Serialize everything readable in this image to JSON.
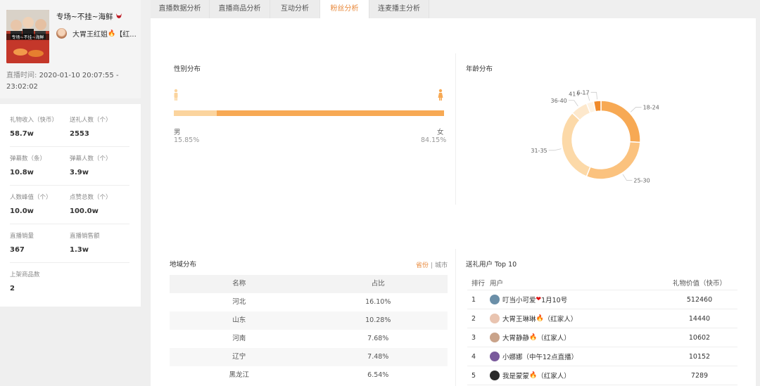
{
  "stream": {
    "title": "专场~不挂~海鲜",
    "thumbnail_caption": "专场~不挂~海鲜",
    "host_name": "大胃王红姐",
    "host_suffix": "【红...",
    "time_label": "直播时间:",
    "time_value": "2020-01-10 20:07:55 - 23:02:02"
  },
  "stats": [
    {
      "label": "礼物收入（快币）",
      "value": "58.7w"
    },
    {
      "label": "送礼人数（个）",
      "value": "2553"
    },
    {
      "label": "弹幕数（条）",
      "value": "10.8w"
    },
    {
      "label": "弹幕人数（个）",
      "value": "3.9w"
    },
    {
      "label": "人数峰值（个）",
      "value": "10.0w"
    },
    {
      "label": "点赞总数（个）",
      "value": "100.0w"
    },
    {
      "label": "直播销量",
      "value": "367"
    },
    {
      "label": "直播销售额",
      "value": "1.3w"
    },
    {
      "label": "上架商品数",
      "value": "2"
    }
  ],
  "tabs": [
    {
      "label": "直播数据分析",
      "active": false
    },
    {
      "label": "直播商品分析",
      "active": false
    },
    {
      "label": "互动分析",
      "active": false
    },
    {
      "label": "粉丝分析",
      "active": true
    },
    {
      "label": "连麦播主分析",
      "active": false
    }
  ],
  "gender": {
    "title": "性别分布",
    "male_label": "男",
    "male_pct": "15.85%",
    "male_fraction": 0.1585,
    "female_label": "女",
    "female_pct": "84.15%",
    "colors": {
      "male": "#fbd49e",
      "female": "#f7a954"
    }
  },
  "age": {
    "title": "年龄分布",
    "chart_data": {
      "type": "pie",
      "categories": [
        "18-24",
        "25-30",
        "31-35",
        "36-40",
        "41+",
        "6-17"
      ],
      "values": [
        26,
        30,
        31,
        7,
        3,
        3
      ],
      "colors": [
        "#f7a954",
        "#fbc27e",
        "#fcd9a8",
        "#fde8cc",
        "#fef3e4",
        "#f08a2a"
      ],
      "legend": "none",
      "labels": "outside"
    }
  },
  "region": {
    "title": "地域分布",
    "toggle_province": "省份",
    "toggle_sep": "|",
    "toggle_city": "城市",
    "headers": [
      "名称",
      "占比"
    ],
    "rows": [
      [
        "河北",
        "16.10%"
      ],
      [
        "山东",
        "10.28%"
      ],
      [
        "河南",
        "7.68%"
      ],
      [
        "辽宁",
        "7.48%"
      ],
      [
        "黑龙江",
        "6.54%"
      ]
    ]
  },
  "gifts": {
    "title": "送礼用户 Top 10",
    "headers": [
      "排行",
      "用户",
      "礼物价值（快币）"
    ],
    "rows": [
      {
        "rank": "1",
        "user": "叮当小可爱",
        "suffix": "1月10号",
        "value": "512460",
        "emoji": "heart",
        "avatar": "#6b8fa8"
      },
      {
        "rank": "2",
        "user": "大胃王琳琳",
        "suffix": "（红家人）",
        "value": "14440",
        "emoji": "flame",
        "avatar": "#e9c4b0"
      },
      {
        "rank": "3",
        "user": "大胃静静",
        "suffix": "（红家人）",
        "value": "10602",
        "emoji": "flame",
        "avatar": "#c9a38a"
      },
      {
        "rank": "4",
        "user": "小娜娜（中午12点直播）",
        "suffix": "",
        "value": "10152",
        "emoji": "",
        "avatar": "#7a5a9c"
      },
      {
        "rank": "5",
        "user": "我是蒙蒙",
        "suffix": "（红家人）",
        "value": "7289",
        "emoji": "flame",
        "avatar": "#2a2a2a"
      }
    ]
  }
}
